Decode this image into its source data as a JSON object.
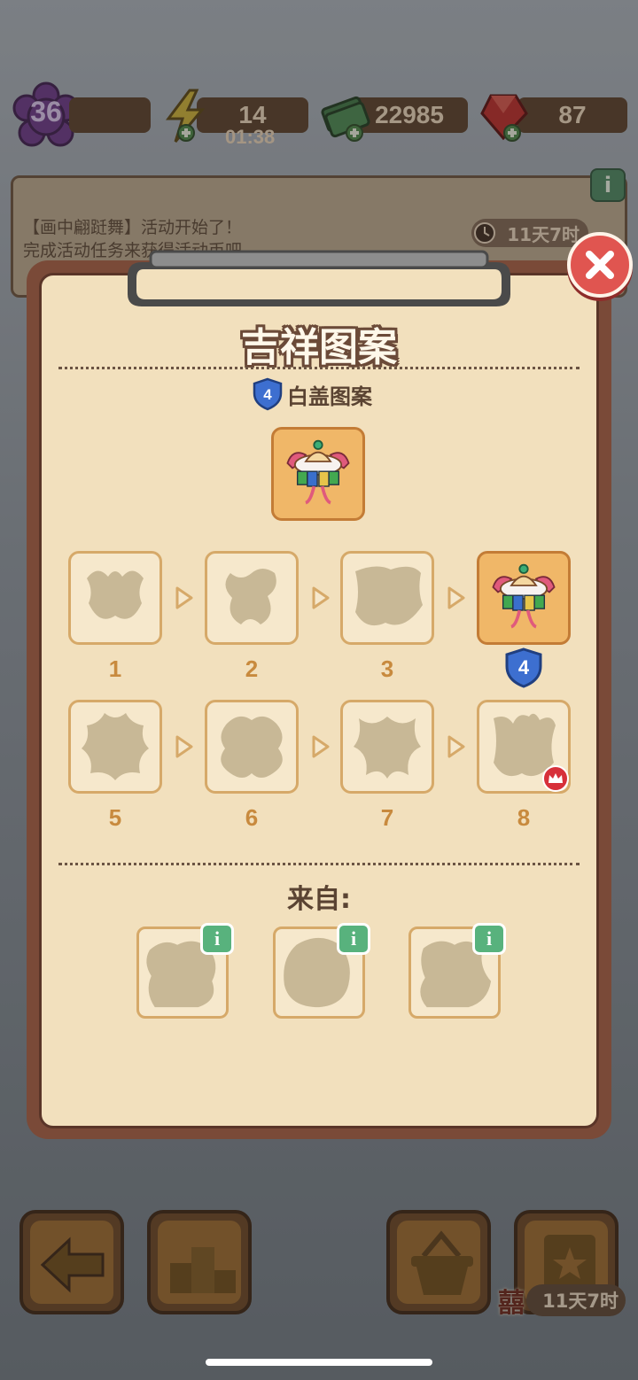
{
  "hud": {
    "level": "36",
    "energy": "14",
    "energy_timer": "01:38",
    "cash": "22985",
    "gems": "87"
  },
  "notice": {
    "line1": "【画中翩跹舞】活动开始了！",
    "line2": "完成活动任务来获得活动币吧",
    "timer": "11天7时",
    "info_label": "i"
  },
  "dialog": {
    "title": "吉祥图案",
    "item_name": "白盖图案",
    "item_level": "4",
    "chain": [
      {
        "label": "1",
        "unlocked": false
      },
      {
        "label": "2",
        "unlocked": false
      },
      {
        "label": "3",
        "unlocked": false
      },
      {
        "label": "4",
        "unlocked": true
      },
      {
        "label": "5",
        "unlocked": false
      },
      {
        "label": "6",
        "unlocked": false
      },
      {
        "label": "7",
        "unlocked": false
      },
      {
        "label": "8",
        "unlocked": false
      }
    ],
    "current_level_badge": "4",
    "from_label": "来自:",
    "sources": [
      {
        "info_label": "i"
      },
      {
        "info_label": "i"
      },
      {
        "info_label": "i"
      }
    ]
  },
  "bottom": {
    "event_timer": "11天7时",
    "event_char": "囍"
  },
  "colors": {
    "panel_bg": "#f2e0bd",
    "panel_border": "#7a4a38",
    "tile_locked": "#f6e8cc",
    "tile_active": "#f0b768",
    "level_label": "#c88a3e",
    "close_red": "#e05550",
    "info_green": "#58b27d"
  }
}
